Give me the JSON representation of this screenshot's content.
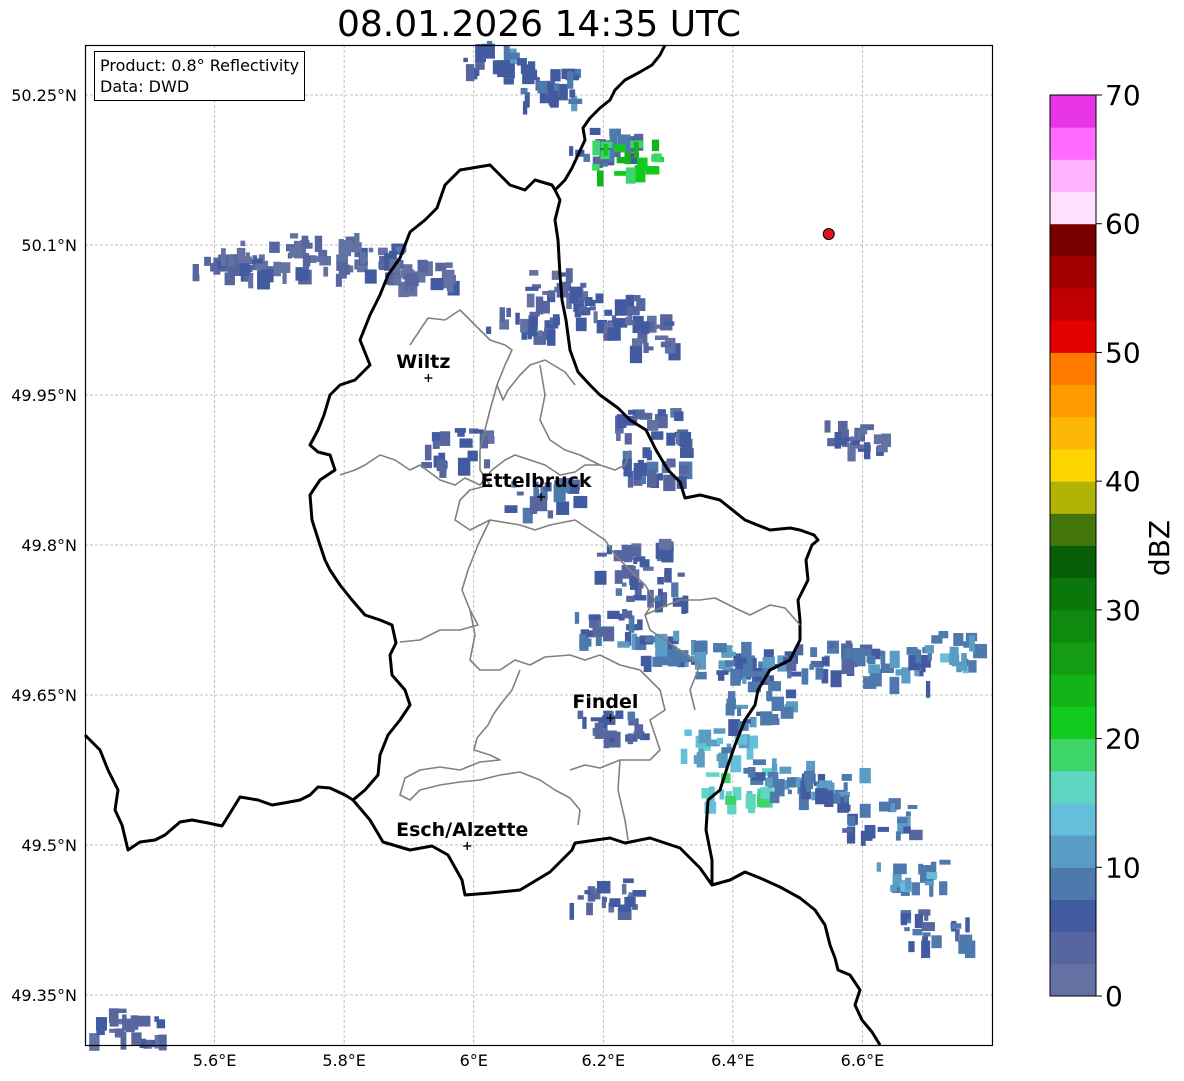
{
  "title": "08.01.2026 14:35 UTC",
  "info": {
    "product": "Product: 0.8° Reflectivity",
    "data_source": "Data: DWD"
  },
  "map": {
    "lon_range": [
      5.4,
      6.8
    ],
    "lat_range": [
      49.3,
      50.3
    ],
    "lon_ticks": [
      {
        "value": 5.6,
        "label": "5.6°E"
      },
      {
        "value": 5.8,
        "label": "5.8°E"
      },
      {
        "value": 6.0,
        "label": "6°E"
      },
      {
        "value": 6.2,
        "label": "6.2°E"
      },
      {
        "value": 6.4,
        "label": "6.4°E"
      },
      {
        "value": 6.6,
        "label": "6.6°E"
      }
    ],
    "lat_ticks": [
      {
        "value": 50.25,
        "label": "50.25°N"
      },
      {
        "value": 50.1,
        "label": "50.1°N"
      },
      {
        "value": 49.95,
        "label": "49.95°N"
      },
      {
        "value": 49.8,
        "label": "49.8°N"
      },
      {
        "value": 49.65,
        "label": "49.65°N"
      },
      {
        "value": 49.5,
        "label": "49.5°N"
      },
      {
        "value": 49.35,
        "label": "49.35°N"
      }
    ],
    "grid": true,
    "cities": [
      {
        "name": "Wiltz",
        "lon": 5.93,
        "lat": 49.967
      },
      {
        "name": "Ettelbruck",
        "lon": 6.104,
        "lat": 49.848
      },
      {
        "name": "Findel",
        "lon": 6.211,
        "lat": 49.627
      },
      {
        "name": "Esch/Alzette",
        "lon": 5.99,
        "lat": 49.499
      }
    ],
    "radar_site": {
      "lon": 6.548,
      "lat": 50.111,
      "color": "#e4121a"
    },
    "echoes": [
      {
        "lon": 5.62,
        "lat": 50.085,
        "dbz": 4
      },
      {
        "lon": 5.69,
        "lat": 50.092,
        "dbz": 4
      },
      {
        "lon": 5.77,
        "lat": 50.095,
        "dbz": 3
      },
      {
        "lon": 5.84,
        "lat": 50.088,
        "dbz": 4
      },
      {
        "lon": 5.92,
        "lat": 50.075,
        "dbz": 3
      },
      {
        "lon": 6.07,
        "lat": 50.03,
        "dbz": 5
      },
      {
        "lon": 6.13,
        "lat": 50.06,
        "dbz": 4
      },
      {
        "lon": 6.2,
        "lat": 50.035,
        "dbz": 6
      },
      {
        "lon": 6.25,
        "lat": 50.015,
        "dbz": 5
      },
      {
        "lon": 6.27,
        "lat": 49.92,
        "dbz": 5
      },
      {
        "lon": 6.28,
        "lat": 49.885,
        "dbz": 6
      },
      {
        "lon": 6.24,
        "lat": 49.79,
        "dbz": 5
      },
      {
        "lon": 6.27,
        "lat": 49.76,
        "dbz": 6
      },
      {
        "lon": 6.2,
        "lat": 49.72,
        "dbz": 8
      },
      {
        "lon": 6.3,
        "lat": 49.7,
        "dbz": 9
      },
      {
        "lon": 6.38,
        "lat": 49.69,
        "dbz": 10
      },
      {
        "lon": 6.45,
        "lat": 49.68,
        "dbz": 8
      },
      {
        "lon": 6.55,
        "lat": 49.69,
        "dbz": 7
      },
      {
        "lon": 6.65,
        "lat": 49.68,
        "dbz": 9
      },
      {
        "lon": 6.72,
        "lat": 49.7,
        "dbz": 12
      },
      {
        "lon": 6.37,
        "lat": 49.6,
        "dbz": 13
      },
      {
        "lon": 6.4,
        "lat": 49.56,
        "dbz": 16
      },
      {
        "lon": 6.47,
        "lat": 49.57,
        "dbz": 10
      },
      {
        "lon": 6.55,
        "lat": 49.56,
        "dbz": 9
      },
      {
        "lon": 6.62,
        "lat": 49.53,
        "dbz": 8
      },
      {
        "lon": 6.67,
        "lat": 49.47,
        "dbz": 11
      },
      {
        "lon": 6.71,
        "lat": 49.42,
        "dbz": 7
      },
      {
        "lon": 6.21,
        "lat": 49.62,
        "dbz": 6
      },
      {
        "lon": 6.44,
        "lat": 49.64,
        "dbz": 9
      },
      {
        "lon": 6.1,
        "lat": 49.85,
        "dbz": 6
      },
      {
        "lon": 6.58,
        "lat": 49.91,
        "dbz": 4
      },
      {
        "lon": 6.2,
        "lat": 50.205,
        "dbz": 7
      },
      {
        "lon": 6.23,
        "lat": 50.19,
        "dbz": 22
      },
      {
        "lon": 6.1,
        "lat": 50.26,
        "dbz": 8
      },
      {
        "lon": 6.03,
        "lat": 50.29,
        "dbz": 8
      },
      {
        "lon": 5.46,
        "lat": 49.32,
        "dbz": 5
      },
      {
        "lon": 5.97,
        "lat": 49.9,
        "dbz": 5
      },
      {
        "lon": 6.2,
        "lat": 49.45,
        "dbz": 5
      }
    ]
  },
  "colorbar": {
    "label": "dBZ",
    "min": 0,
    "max": 70,
    "ticks": [
      0,
      10,
      20,
      30,
      40,
      50,
      60,
      70
    ],
    "tick_labels": [
      "0",
      "10",
      "20",
      "30",
      "40",
      "50",
      "60",
      "70"
    ],
    "colors": [
      "#6472a3",
      "#57669f",
      "#425a9f",
      "#4e79ad",
      "#5b9cc4",
      "#65bfdb",
      "#5fd5c2",
      "#3dd56a",
      "#12c91e",
      "#13b319",
      "#149c14",
      "#0e8a0e",
      "#0b770b",
      "#075e07",
      "#43750d",
      "#b0b407",
      "#ffd500",
      "#fdb705",
      "#fd9b00",
      "#ff7b00",
      "#e50000",
      "#c00000",
      "#a30000",
      "#7a0000",
      "#ffe0ff",
      "#ffb3ff",
      "#ff6cff",
      "#e634e6"
    ]
  }
}
